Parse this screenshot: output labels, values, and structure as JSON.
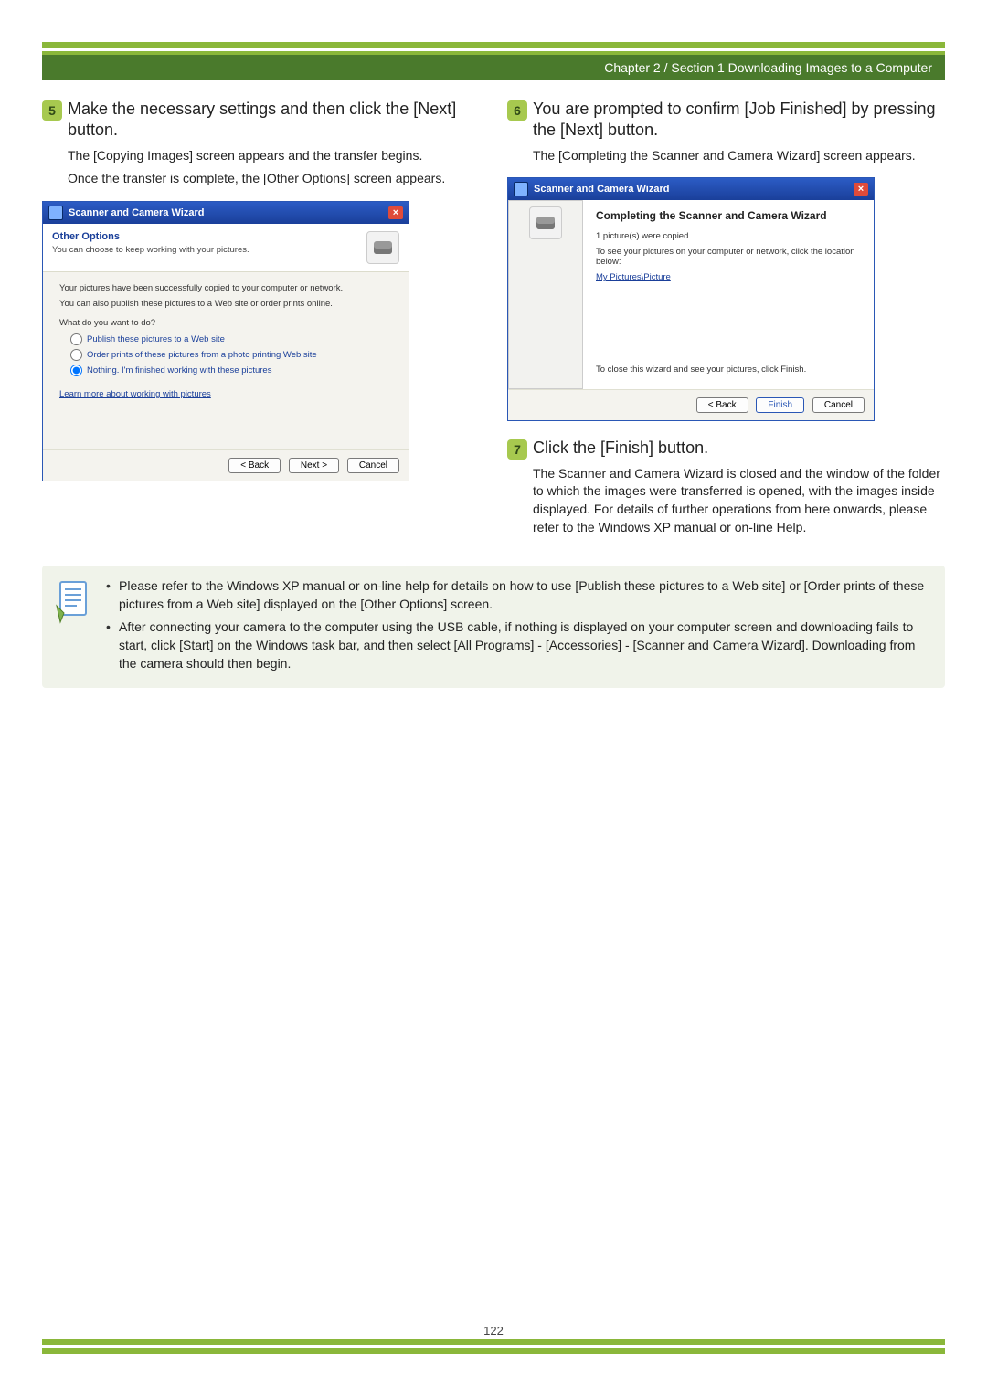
{
  "chapter_header": "Chapter 2 / Section 1  Downloading Images to a Computer",
  "page_number": "122",
  "steps": {
    "s5": {
      "num": "5",
      "title": "Make the necessary settings and then click the [Next] button.",
      "body_a": "The [Copying Images] screen appears and the transfer begins.",
      "body_b": "Once the transfer is complete, the [Other Options] screen appears."
    },
    "s6": {
      "num": "6",
      "title": "You are prompted to confirm [Job Finished] by pressing the [Next] button.",
      "body_a": "The [Completing the Scanner and Camera Wizard] screen appears."
    },
    "s7": {
      "num": "7",
      "title": "Click the [Finish] button.",
      "body_a": "The Scanner and Camera Wizard is closed and the window of the folder to which the images were transferred is opened, with the images inside displayed. For details of further operations from here onwards, please refer to the Windows XP manual or on-line Help."
    }
  },
  "note": {
    "item1": "Please refer to the Windows XP manual or on-line help for details on how to use [Publish these pictures to a Web site] or [Order prints of these pictures from a Web site] displayed on the [Other Options] screen.",
    "item2": "After connecting your camera to the computer using the USB cable, if nothing is displayed on your computer screen and downloading fails to start, click [Start] on the Windows task bar, and then select [All Programs] - [Accessories] - [Scanner and Camera Wizard]. Downloading from the camera should then begin."
  },
  "win1": {
    "title": "Scanner and Camera Wizard",
    "close": "×",
    "header_title": "Other Options",
    "header_sub": "You can choose to keep working with your pictures.",
    "line1": "Your pictures have been successfully copied to your computer or network.",
    "line2": "You can also publish these pictures to a Web site or order prints online.",
    "prompt": "What do you want to do?",
    "opt1": "Publish these pictures to a Web site",
    "opt2": "Order prints of these pictures from a photo printing Web site",
    "opt3": "Nothing. I'm finished working with these pictures",
    "learn_more": "Learn more about working with pictures",
    "btn_back": "< Back",
    "btn_next": "Next >",
    "btn_cancel": "Cancel"
  },
  "win2": {
    "title": "Scanner and Camera Wizard",
    "close": "×",
    "header_title": "Completing the Scanner and Camera Wizard",
    "copied": "1 picture(s) were copied.",
    "see": "To see your pictures on your computer or network, click the location below:",
    "link": "My Pictures\\Picture",
    "closing": "To close this wizard and see your pictures, click Finish.",
    "btn_back": "< Back",
    "btn_finish": "Finish",
    "btn_cancel": "Cancel"
  }
}
